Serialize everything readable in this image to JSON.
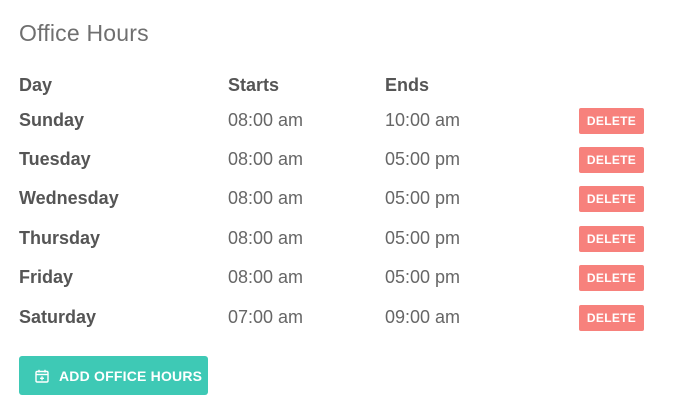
{
  "page": {
    "title": "Office Hours"
  },
  "table": {
    "headers": {
      "day": "Day",
      "starts": "Starts",
      "ends": "Ends"
    },
    "rows": [
      {
        "day": "Sunday",
        "starts": "08:00 am",
        "ends": "10:00 am",
        "action": "DELETE"
      },
      {
        "day": "Tuesday",
        "starts": "08:00 am",
        "ends": "05:00 pm",
        "action": "DELETE"
      },
      {
        "day": "Wednesday",
        "starts": "08:00 am",
        "ends": "05:00 pm",
        "action": "DELETE"
      },
      {
        "day": "Thursday",
        "starts": "08:00 am",
        "ends": "05:00 pm",
        "action": "DELETE"
      },
      {
        "day": "Friday",
        "starts": "08:00 am",
        "ends": "05:00 pm",
        "action": "DELETE"
      },
      {
        "day": "Saturday",
        "starts": "07:00 am",
        "ends": "09:00 am",
        "action": "DELETE"
      }
    ]
  },
  "add_button": {
    "label": "ADD OFFICE HOURS",
    "icon": "calendar-plus-icon"
  },
  "colors": {
    "delete_button": "#f7817c",
    "add_button": "#3ec9b5"
  }
}
